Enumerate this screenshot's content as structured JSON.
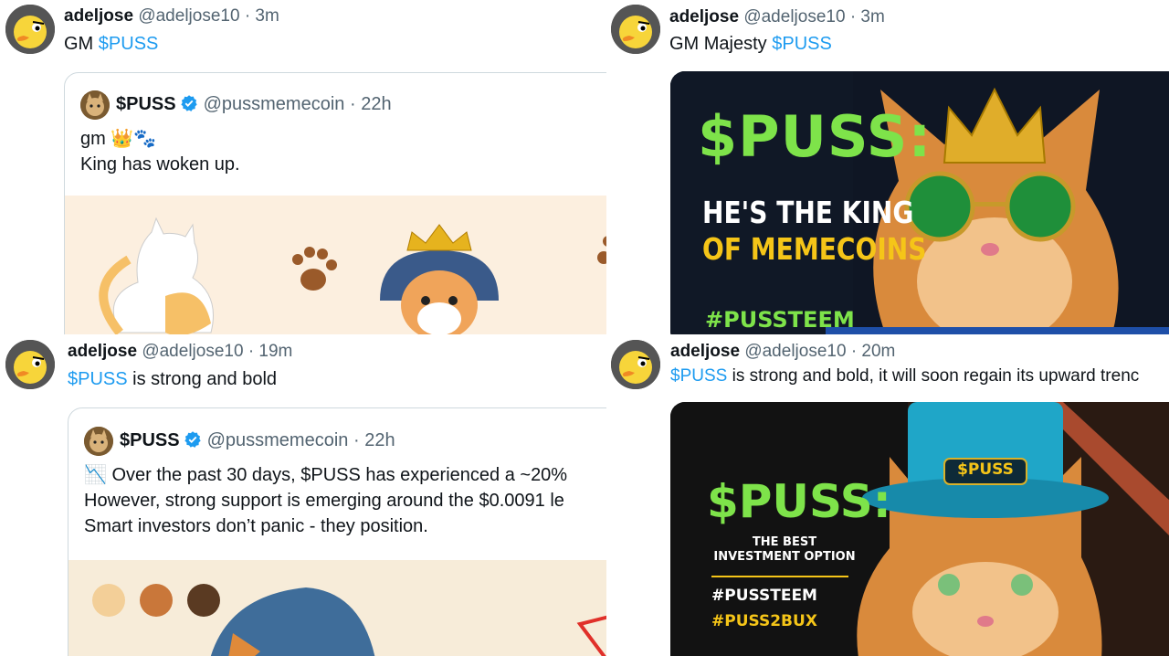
{
  "tweets": [
    {
      "name": "adeljose",
      "handle": "@adeljose10",
      "dot": "·",
      "time": "3m",
      "text_prefix": "GM ",
      "cashtag": "$PUSS",
      "text_suffix": "",
      "quote": {
        "name": "$PUSS",
        "handle": "@pussmemecoin",
        "dot": "·",
        "time": "22h",
        "line1": "gm 👑🐾",
        "line2": "King has woken up."
      }
    },
    {
      "name": "adeljose",
      "handle": "@adeljose10",
      "dot": "·",
      "time": "3m",
      "text_prefix": "GM Majesty ",
      "cashtag": "$PUSS",
      "text_suffix": "",
      "image": {
        "headline": "$PUSS:",
        "line1": "HE'S THE KING",
        "line2": "OF MEMECOINS",
        "hashtag": "#PUSSTEEM"
      }
    },
    {
      "name": "adeljose",
      "handle": "@adeljose10",
      "dot": "·",
      "time": "19m",
      "text_prefix": "",
      "cashtag": "$PUSS",
      "text_suffix": " is strong and bold",
      "quote": {
        "name": "$PUSS",
        "handle": "@pussmemecoin",
        "dot": "·",
        "time": "22h",
        "line1": "📉 Over the past 30 days, $PUSS has experienced a ~20%",
        "line2": "However, strong support is emerging around the $0.0091 le",
        "line3": "Smart investors don’t panic - they position."
      }
    },
    {
      "name": "adeljose",
      "handle": "@adeljose10",
      "dot": "·",
      "time": "20m",
      "text_prefix": "",
      "cashtag": "$PUSS",
      "text_suffix": " is strong and bold, it will soon regain its upward trenc",
      "image": {
        "headline": "$PUSS:",
        "hat_label": "$PUSS",
        "sub1": "THE BEST",
        "sub2": "INVESTMENT OPTION",
        "hashtag1": "#PUSSTEEM",
        "hashtag2": "#PUSS2BUX"
      }
    }
  ],
  "colors": {
    "link": "#1d9bf0",
    "secondary_text": "#536471",
    "verified": "#1d9bf0",
    "headline_green": "#7ee34a",
    "headline_yellow": "#f5c518"
  },
  "icons": [
    "duck-avatar-icon",
    "puss-avatar-icon",
    "verified-badge-icon",
    "chart-down-emoji"
  ]
}
